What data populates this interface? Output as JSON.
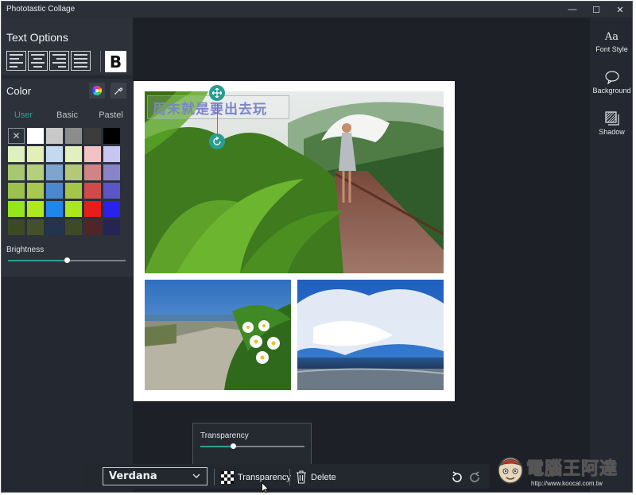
{
  "window": {
    "title": "Phototastic Collage",
    "controls": {
      "minimize": "—",
      "maximize": "☐",
      "close": "✕"
    }
  },
  "text_options": {
    "title": "Text Options",
    "alignments": [
      "align-left",
      "align-center",
      "align-right",
      "align-justify"
    ],
    "bold_label": "B"
  },
  "color": {
    "title": "Color",
    "tabs": [
      "User",
      "Basic",
      "Pastel"
    ],
    "active_tab": "User",
    "swatches": [
      [
        "none",
        "#ffffff",
        "#c8c8c8",
        "#8c8c8c",
        "#3c3c3c",
        "#000000"
      ],
      [
        "#dff0c0",
        "#e2efb8",
        "#c4d9f0",
        "#e4efc0",
        "#f2c2c4",
        "#c8c6f0"
      ],
      [
        "#a6c870",
        "#b4d07a",
        "#7fa4d0",
        "#b4c87a",
        "#d08486",
        "#8884c8"
      ],
      [
        "#9ac24c",
        "#a8c84e",
        "#4c88d0",
        "#a4c44c",
        "#d04a4c",
        "#5a56c8"
      ],
      [
        "#96e61c",
        "#aee820",
        "#2286e8",
        "#a8e81c",
        "#e81c1c",
        "#2a22e8"
      ],
      [
        "#3c4a24",
        "#44502a",
        "#22344e",
        "#3e4a26",
        "#4e2628",
        "#262454"
      ]
    ],
    "brightness_label": "Brightness",
    "brightness_value": 0.5
  },
  "right_panel": {
    "font_style_glyph": "Aa",
    "font_style_label": "Font Style",
    "background_label": "Background",
    "shadow_label": "Shadow"
  },
  "collage": {
    "text_overlay": "周末就是要出去玩"
  },
  "bottom_bar": {
    "font_name": "Verdana",
    "transparency_label": "Transparency",
    "delete_label": "Delete"
  },
  "transparency_popup": {
    "label": "Transparency",
    "value": 0.31
  },
  "watermark": {
    "text": "電腦王阿達",
    "url": "http://www.koocal.com.tw"
  },
  "colors": {
    "accent": "#2f9e95",
    "window_bg": "#232831",
    "canvas_bg": "#1d2026"
  }
}
